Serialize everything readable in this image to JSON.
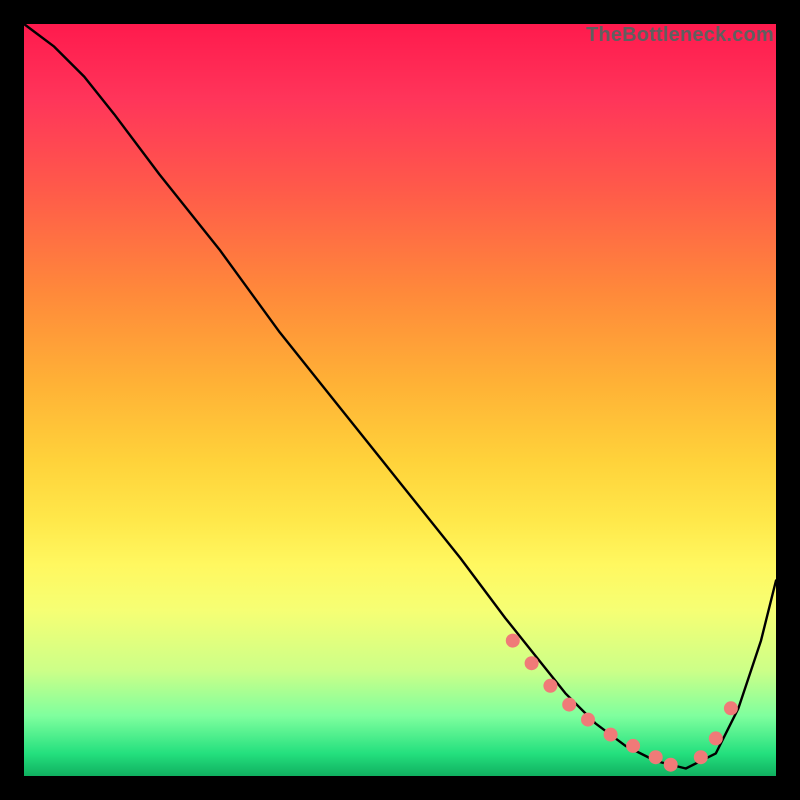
{
  "watermark": "TheBottleneck.com",
  "colors": {
    "curve": "#000000",
    "points": "#f07a78",
    "frame": "#000000"
  },
  "chart_data": {
    "type": "line",
    "title": "",
    "xlabel": "",
    "ylabel": "",
    "xlim": [
      0,
      100
    ],
    "ylim": [
      0,
      100
    ],
    "series": [
      {
        "name": "bottleneck-curve",
        "x": [
          0,
          4,
          8,
          12,
          18,
          26,
          34,
          42,
          50,
          58,
          64,
          68,
          72,
          76,
          80,
          84,
          88,
          92,
          95,
          98,
          100
        ],
        "y": [
          100,
          97,
          93,
          88,
          80,
          70,
          59,
          49,
          39,
          29,
          21,
          16,
          11,
          7,
          4,
          2,
          1,
          3,
          9,
          18,
          26
        ]
      }
    ],
    "highlight_points": {
      "name": "optimal-range-points",
      "x": [
        65,
        67.5,
        70,
        72.5,
        75,
        78,
        81,
        84,
        86,
        90,
        92,
        94
      ],
      "y": [
        18,
        15,
        12,
        9.5,
        7.5,
        5.5,
        4,
        2.5,
        1.5,
        2.5,
        5,
        9
      ]
    }
  }
}
